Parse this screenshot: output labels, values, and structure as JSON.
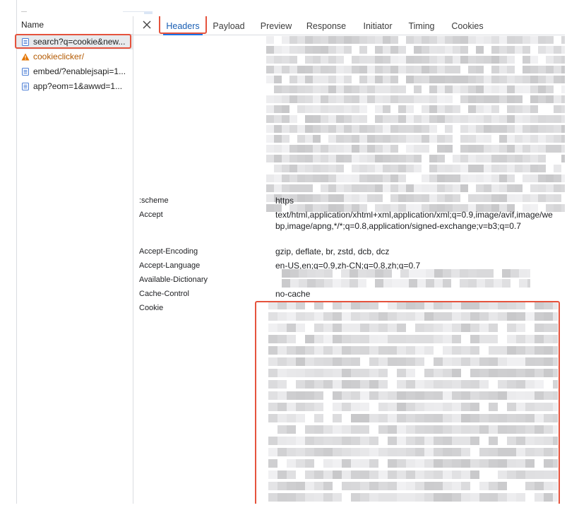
{
  "request_list": {
    "column_header": "Name",
    "items": [
      {
        "label": "search?q=cookie&new...",
        "type": "document",
        "selected": true
      },
      {
        "label": "cookieclicker/",
        "type": "warning",
        "selected": false
      },
      {
        "label": "embed/?enablejsapi=1...",
        "type": "document",
        "selected": false
      },
      {
        "label": "app?eom=1&awwd=1...",
        "type": "document",
        "selected": false
      }
    ]
  },
  "tabs": [
    {
      "label": "Headers",
      "active": true
    },
    {
      "label": "Payload",
      "active": false
    },
    {
      "label": "Preview",
      "active": false
    },
    {
      "label": "Response",
      "active": false
    },
    {
      "label": "Initiator",
      "active": false
    },
    {
      "label": "Timing",
      "active": false
    },
    {
      "label": "Cookies",
      "active": false
    }
  ],
  "headers": [
    {
      "name": ":scheme",
      "value": "https"
    },
    {
      "name": "Accept",
      "value": "text/html,application/xhtml+xml,application/xml;q=0.9,image/avif,image/webp,image/apng,*/*;q=0.8,application/signed-exchange;v=b3;q=0.7"
    },
    {
      "name": "Accept-Encoding",
      "value": "gzip, deflate, br, zstd, dcb, dcz"
    },
    {
      "name": "Accept-Language",
      "value": "en-US,en;q=0.9,zh-CN;q=0.8,zh;q=0.7"
    },
    {
      "name": "Available-Dictionary",
      "value": ""
    },
    {
      "name": "Cache-Control",
      "value": "no-cache"
    },
    {
      "name": "Cookie",
      "value": ""
    }
  ],
  "colors": {
    "highlight": "#e5533d",
    "active_tab": "#1a73e8",
    "warning": "#e37400",
    "document_icon": "#4d7fd6"
  }
}
